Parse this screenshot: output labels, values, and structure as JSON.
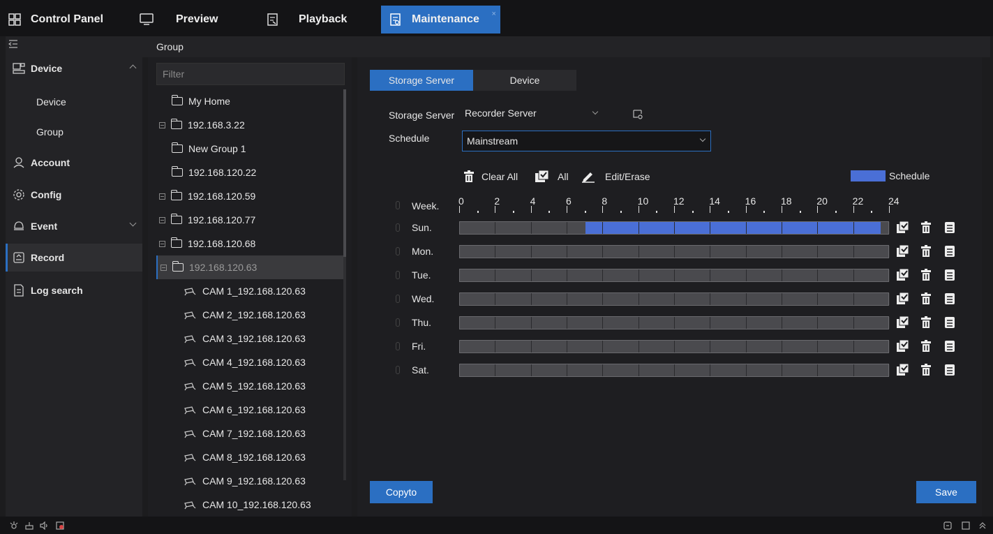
{
  "tabs": [
    {
      "label": "Control Panel",
      "icon": "grid-icon"
    },
    {
      "label": "Preview",
      "icon": "monitor-icon"
    },
    {
      "label": "Playback",
      "icon": "playback-icon"
    },
    {
      "label": "Maintenance",
      "icon": "maintenance-icon",
      "active": true,
      "close": "×"
    }
  ],
  "sidebar": {
    "items": [
      {
        "label": "Device",
        "icon": "device-icon",
        "expanded": true
      },
      {
        "label": "Device",
        "sub": true
      },
      {
        "label": "Group",
        "sub": true
      },
      {
        "label": "Account",
        "icon": "account-icon"
      },
      {
        "label": "Config",
        "icon": "gear-icon"
      },
      {
        "label": "Event",
        "icon": "event-icon",
        "expandable": true
      },
      {
        "label": "Record",
        "icon": "record-icon",
        "active": true
      },
      {
        "label": "Log search",
        "icon": "document-icon"
      }
    ]
  },
  "group_header": "Group",
  "tree": {
    "filter_placeholder": "Filter",
    "items": [
      {
        "label": "My Home",
        "type": "folder"
      },
      {
        "label": "192.168.3.22",
        "type": "folder",
        "expander": true
      },
      {
        "label": "New Group 1",
        "type": "folder"
      },
      {
        "label": "192.168.120.22",
        "type": "folder"
      },
      {
        "label": "192.168.120.59",
        "type": "folder",
        "expander": true
      },
      {
        "label": "192.168.120.77",
        "type": "folder",
        "expander": true
      },
      {
        "label": "192.168.120.68",
        "type": "folder",
        "expander": true
      },
      {
        "label": "192.168.120.63",
        "type": "folder",
        "expander": true,
        "selected": true
      },
      {
        "label": "CAM 1_192.168.120.63",
        "type": "camera"
      },
      {
        "label": "CAM 2_192.168.120.63",
        "type": "camera"
      },
      {
        "label": "CAM 3_192.168.120.63",
        "type": "camera"
      },
      {
        "label": "CAM 4_192.168.120.63",
        "type": "camera"
      },
      {
        "label": "CAM 5_192.168.120.63",
        "type": "camera"
      },
      {
        "label": "CAM 6_192.168.120.63",
        "type": "camera"
      },
      {
        "label": "CAM 7_192.168.120.63",
        "type": "camera"
      },
      {
        "label": "CAM 8_192.168.120.63",
        "type": "camera"
      },
      {
        "label": "CAM 9_192.168.120.63",
        "type": "camera"
      },
      {
        "label": "CAM 10_192.168.120.63",
        "type": "camera"
      }
    ]
  },
  "main": {
    "subtabs": [
      "Storage Server",
      "Device"
    ],
    "storage_server_label": "Storage Server",
    "storage_server_value": "Recorder Server",
    "schedule_label": "Schedule",
    "schedule_value": "Mainstream",
    "toolbar": {
      "clear_all": "Clear All",
      "all": "All",
      "edit_erase": "Edit/Erase"
    },
    "legend": "Schedule",
    "week_label": "Week.",
    "hour_labels": [
      "0",
      "2",
      "4",
      "6",
      "8",
      "10",
      "12",
      "14",
      "16",
      "18",
      "20",
      "22",
      "24"
    ],
    "days": [
      {
        "label": "Sun.",
        "fill_start_hour": 7,
        "fill_end_hour": 23.5
      },
      {
        "label": "Mon."
      },
      {
        "label": "Tue."
      },
      {
        "label": "Wed."
      },
      {
        "label": "Thu."
      },
      {
        "label": "Fri."
      },
      {
        "label": "Sat."
      }
    ],
    "copyto_label": "Copyto",
    "save_label": "Save"
  },
  "colors": {
    "accent": "#2b6fc2",
    "schedule_fill": "#4a6fd6"
  }
}
